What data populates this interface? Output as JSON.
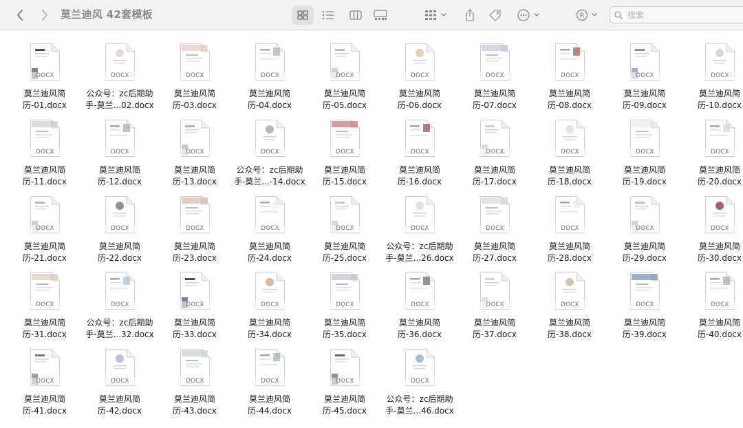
{
  "window": {
    "title": "莫兰迪风 42套模板"
  },
  "toolbar": {
    "back_icon": "chevron-left-icon",
    "forward_icon": "chevron-right-icon",
    "view_icons": [
      "grid-view-icon",
      "list-view-icon",
      "column-view-icon",
      "gallery-view-icon"
    ],
    "group_icon": "group-by-icon",
    "share_icon": "share-icon",
    "tag_icon": "tag-icon",
    "more_icon": "more-actions-icon",
    "account_icon": "registered-icon"
  },
  "search": {
    "placeholder": "搜索",
    "value": ""
  },
  "file_ext": "DOCX",
  "files": [
    "莫兰迪风简历-01.docx",
    "公众号：zc后期助手-莫兰...02.docx",
    "莫兰迪风简历-03.docx",
    "莫兰迪风简历-04.docx",
    "莫兰迪风简历-05.docx",
    "莫兰迪风简历-06.docx",
    "莫兰迪风简历-07.docx",
    "莫兰迪风简历-08.docx",
    "莫兰迪风简历-09.docx",
    "莫兰迪风简历-10.docx",
    "莫兰迪风简历-11.docx",
    "莫兰迪风简历-12.docx",
    "莫兰迪风简历-13.docx",
    "公众号：zc后期助手-莫兰...-14.docx",
    "莫兰迪风简历-15.docx",
    "莫兰迪风简历-16.docx",
    "莫兰迪风简历-17.docx",
    "莫兰迪风简历-18.docx",
    "莫兰迪风简历-19.docx",
    "莫兰迪风简历-20.docx",
    "莫兰迪风简历-21.docx",
    "莫兰迪风简历-22.docx",
    "莫兰迪风简历-23.docx",
    "莫兰迪风简历-24.docx",
    "莫兰迪风简历-25.docx",
    "公众号：zc后期助手-莫兰...26.docx",
    "莫兰迪风简历-27.docx",
    "莫兰迪风简历-28.docx",
    "莫兰迪风简历-29.docx",
    "莫兰迪风简历-30.docx",
    "莫兰迪风简历-31.docx",
    "公众号：zc后期助手-莫兰...32.docx",
    "莫兰迪风简历-33.docx",
    "莫兰迪风简历-34.docx",
    "莫兰迪风简历-35.docx",
    "莫兰迪风简历-36.docx",
    "莫兰迪风简历-37.docx",
    "莫兰迪风简历-38.docx",
    "莫兰迪风简历-39.docx",
    "莫兰迪风简历-40.docx",
    "莫兰迪风简历-41.docx",
    "莫兰迪风简历-42.docx",
    "莫兰迪风简历-43.docx",
    "莫兰迪风简历-44.docx",
    "莫兰迪风简历-45.docx",
    "公众号：zc后期助手-莫兰...46.docx"
  ],
  "file_lines": [
    [
      "莫兰迪风简",
      "历-01.docx"
    ],
    [
      "公众号：zc后期助",
      "手-莫兰...02.docx"
    ],
    [
      "莫兰迪风简",
      "历-03.docx"
    ],
    [
      "莫兰迪风简",
      "历-04.docx"
    ],
    [
      "莫兰迪风简",
      "历-05.docx"
    ],
    [
      "莫兰迪风简",
      "历-06.docx"
    ],
    [
      "莫兰迪风简",
      "历-07.docx"
    ],
    [
      "莫兰迪风简",
      "历-08.docx"
    ],
    [
      "莫兰迪风简",
      "历-09.docx"
    ],
    [
      "莫兰迪风简",
      "历-10.docx"
    ],
    [
      "莫兰迪风简",
      "历-11.docx"
    ],
    [
      "莫兰迪风简",
      "历-12.docx"
    ],
    [
      "莫兰迪风简",
      "历-13.docx"
    ],
    [
      "公众号：zc后期助",
      "手-莫兰...-14.docx"
    ],
    [
      "莫兰迪风简",
      "历-15.docx"
    ],
    [
      "莫兰迪风简",
      "历-16.docx"
    ],
    [
      "莫兰迪风简",
      "历-17.docx"
    ],
    [
      "莫兰迪风简",
      "历-18.docx"
    ],
    [
      "莫兰迪风简",
      "历-19.docx"
    ],
    [
      "莫兰迪风简",
      "历-20.docx"
    ],
    [
      "莫兰迪风简",
      "历-21.docx"
    ],
    [
      "莫兰迪风简",
      "历-22.docx"
    ],
    [
      "莫兰迪风简",
      "历-23.docx"
    ],
    [
      "莫兰迪风简",
      "历-24.docx"
    ],
    [
      "莫兰迪风简",
      "历-25.docx"
    ],
    [
      "公众号：zc后期助",
      "手-莫兰...26.docx"
    ],
    [
      "莫兰迪风简",
      "历-27.docx"
    ],
    [
      "莫兰迪风简",
      "历-28.docx"
    ],
    [
      "莫兰迪风简",
      "历-29.docx"
    ],
    [
      "莫兰迪风简",
      "历-30.docx"
    ],
    [
      "莫兰迪风简",
      "历-31.docx"
    ],
    [
      "公众号：zc后期助",
      "手-莫兰...32.docx"
    ],
    [
      "莫兰迪风简",
      "历-33.docx"
    ],
    [
      "莫兰迪风简",
      "历-34.docx"
    ],
    [
      "莫兰迪风简",
      "历-35.docx"
    ],
    [
      "莫兰迪风简",
      "历-36.docx"
    ],
    [
      "莫兰迪风简",
      "历-37.docx"
    ],
    [
      "莫兰迪风简",
      "历-38.docx"
    ],
    [
      "莫兰迪风简",
      "历-39.docx"
    ],
    [
      "莫兰迪风简",
      "历-40.docx"
    ],
    [
      "莫兰迪风简",
      "历-41.docx"
    ],
    [
      "莫兰迪风简",
      "历-42.docx"
    ],
    [
      "莫兰迪风简",
      "历-43.docx"
    ],
    [
      "莫兰迪风简",
      "历-44.docx"
    ],
    [
      "莫兰迪风简",
      "历-45.docx"
    ],
    [
      "公众号：zc后期助",
      "手-莫兰...46.docx"
    ]
  ],
  "thumb_accents": [
    "#4a4f55",
    "#d9cfc4",
    "#d8b9b0",
    "#9aa89a",
    "#b7c3b2",
    "#d8c2a8",
    "#aab6c8",
    "#8c3b3b",
    "#7d93a8",
    "#c8c8c8",
    "#bfbfbf",
    "#8ea497",
    "#aab2bd",
    "#9aa3ae",
    "#b04a4a",
    "#7a2f35",
    "#cfcfcf",
    "#dcdcdc",
    "#e6e6e6",
    "#d0d0d0",
    "#a9bcc9",
    "#6f6f6f",
    "#c9a98e",
    "#ececec",
    "#d5c8bd",
    "#d7d7d7",
    "#c6cbd3",
    "#e9e9e9",
    "#bfbfbf",
    "#8b2e33",
    "#d6b9a7",
    "#9bb3c7",
    "#3f4f63",
    "#c9a27d",
    "#a7b4be",
    "#3e5b57",
    "#cfd2d6",
    "#c4b19c",
    "#4f6f96",
    "#9a9a9a",
    "#767676",
    "#b6a6c7",
    "#bac3cc",
    "#8fa79b",
    "#5a6470",
    "#90a7bd"
  ]
}
